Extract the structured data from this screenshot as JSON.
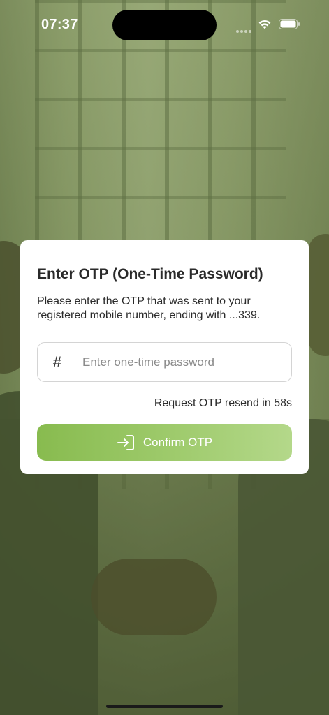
{
  "status_bar": {
    "time": "07:37"
  },
  "otp_card": {
    "title": "Enter OTP (One-Time Password)",
    "description": "Please enter the OTP that was sent to your registered mobile number, ending with ...339.",
    "input": {
      "icon": "hash-icon",
      "symbol": "#",
      "value": "",
      "placeholder": "Enter one-time password"
    },
    "resend_text": "Request OTP resend in 58s",
    "confirm_button": {
      "icon": "login-icon",
      "label": "Confirm OTP"
    }
  },
  "colors": {
    "button_gradient_start": "#88bb4f",
    "button_gradient_end": "#b4d88a",
    "card_background": "#ffffff",
    "text_primary": "#2a2a2a",
    "placeholder": "#8a8a8a",
    "background_tint": "#56633f"
  }
}
